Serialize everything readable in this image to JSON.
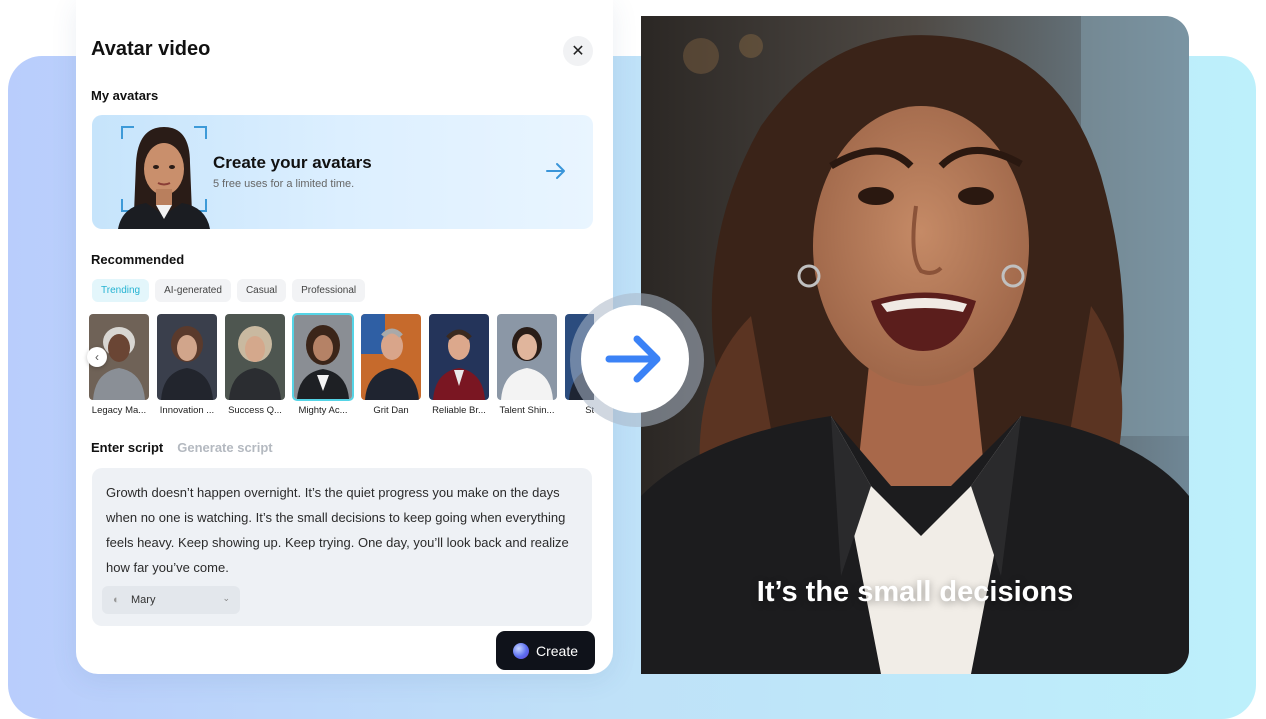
{
  "panel": {
    "title": "Avatar video",
    "close_label": "✕",
    "my_avatars_label": "My avatars",
    "create_card": {
      "title": "Create your avatars",
      "subtitle": "5 free uses for a limited time."
    },
    "recommended_label": "Recommended",
    "tabs": [
      {
        "label": "Trending",
        "active": true
      },
      {
        "label": "AI-generated",
        "active": false
      },
      {
        "label": "Casual",
        "active": false
      },
      {
        "label": "Professional",
        "active": false
      }
    ],
    "avatars": [
      {
        "name": "Legacy Ma...",
        "selected": false
      },
      {
        "name": "Innovation ...",
        "selected": false
      },
      {
        "name": "Success Q...",
        "selected": false
      },
      {
        "name": "Mighty Ac...",
        "selected": true
      },
      {
        "name": "Grit Dan",
        "selected": false
      },
      {
        "name": "Reliable Br...",
        "selected": false
      },
      {
        "name": "Talent Shin...",
        "selected": false
      },
      {
        "name": "Stea",
        "selected": false
      }
    ],
    "script_tab_active": "Enter script",
    "script_tab_inactive": "Generate script",
    "script_text": "Growth doesn’t happen overnight. It’s the quiet progress you make on the days when no one is watching. It’s the small decisions to keep going when everything feels heavy. Keep showing up. Keep trying. One day, you’ll look back and realize how far you’ve come.",
    "voice": {
      "name": "Mary",
      "icon": "mic-icon"
    },
    "create_button_label": "Create"
  },
  "video": {
    "caption": "It’s the small decisions"
  },
  "colors": {
    "accent": "#25b3d2",
    "arrow_blue": "#3b82f6",
    "create_button_bg": "#0f121a"
  }
}
